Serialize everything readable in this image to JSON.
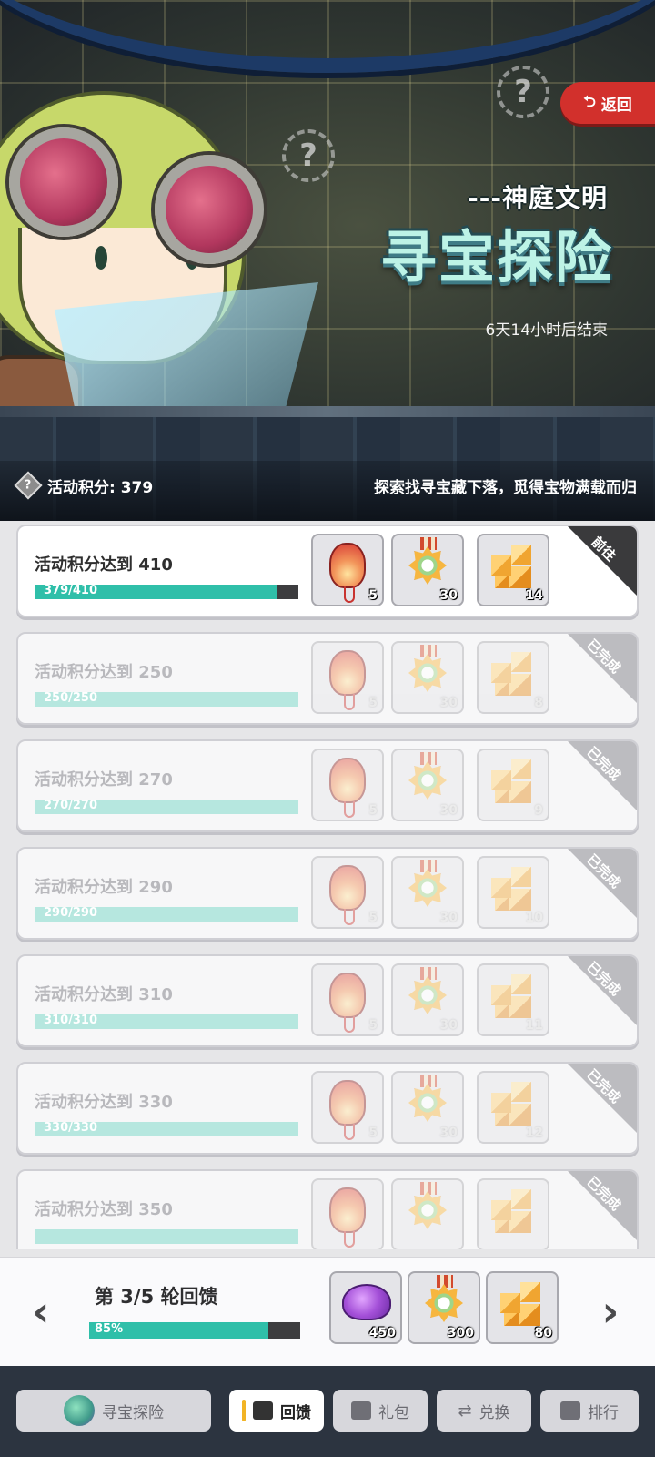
{
  "banner": {
    "back_label": "返回",
    "subtitle": "---神庭文明",
    "title": "寻宝探险",
    "countdown": "6天14小时后结束",
    "score_label": "活动积分: 379",
    "slogan": "探索找寻宝藏下落，觅得宝物满载而归",
    "question_mark": "?"
  },
  "tasks": [
    {
      "title": "活动积分达到 410",
      "progress_text": "379/410",
      "progress": 0.924,
      "status": "前往",
      "done": false,
      "rewards": [
        {
          "icon": "lantern-icon",
          "count": "5"
        },
        {
          "icon": "medal-icon",
          "count": "30"
        },
        {
          "icon": "cubes-icon",
          "count": "14"
        }
      ]
    },
    {
      "title": "活动积分达到 250",
      "progress_text": "250/250",
      "progress": 1.0,
      "status": "已完成",
      "done": true,
      "rewards": [
        {
          "icon": "lantern-icon",
          "count": "5"
        },
        {
          "icon": "medal-icon",
          "count": "30"
        },
        {
          "icon": "cubes-icon",
          "count": "8"
        }
      ]
    },
    {
      "title": "活动积分达到 270",
      "progress_text": "270/270",
      "progress": 1.0,
      "status": "已完成",
      "done": true,
      "rewards": [
        {
          "icon": "lantern-icon",
          "count": "5"
        },
        {
          "icon": "medal-icon",
          "count": "30"
        },
        {
          "icon": "cubes-icon",
          "count": "9"
        }
      ]
    },
    {
      "title": "活动积分达到 290",
      "progress_text": "290/290",
      "progress": 1.0,
      "status": "已完成",
      "done": true,
      "rewards": [
        {
          "icon": "lantern-icon",
          "count": "5"
        },
        {
          "icon": "medal-icon",
          "count": "30"
        },
        {
          "icon": "cubes-icon",
          "count": "10"
        }
      ]
    },
    {
      "title": "活动积分达到 310",
      "progress_text": "310/310",
      "progress": 1.0,
      "status": "已完成",
      "done": true,
      "rewards": [
        {
          "icon": "lantern-icon",
          "count": "5"
        },
        {
          "icon": "medal-icon",
          "count": "30"
        },
        {
          "icon": "cubes-icon",
          "count": "11"
        }
      ]
    },
    {
      "title": "活动积分达到 330",
      "progress_text": "330/330",
      "progress": 1.0,
      "status": "已完成",
      "done": true,
      "rewards": [
        {
          "icon": "lantern-icon",
          "count": "5"
        },
        {
          "icon": "medal-icon",
          "count": "30"
        },
        {
          "icon": "cubes-icon",
          "count": "12"
        }
      ]
    },
    {
      "title": "活动积分达到 350",
      "progress_text": "",
      "progress": 1.0,
      "status": "已完成",
      "done": true,
      "rewards": [
        {
          "icon": "lantern-icon",
          "count": ""
        },
        {
          "icon": "medal-icon",
          "count": ""
        },
        {
          "icon": "cubes-icon",
          "count": ""
        }
      ]
    }
  ],
  "round": {
    "title": "第 3/5 轮回馈",
    "progress_text": "85%",
    "progress": 0.85,
    "rewards": [
      {
        "icon": "gem-icon",
        "count": "450"
      },
      {
        "icon": "medal-icon",
        "count": "300"
      },
      {
        "icon": "cubes-icon",
        "count": "80"
      }
    ],
    "prev_arrow": "‹",
    "next_arrow": "›"
  },
  "nav": {
    "treasure": "寻宝探险",
    "feedback": "回馈",
    "gift": "礼包",
    "exchange": "兑换",
    "rank": "排行"
  },
  "colors": {
    "accent_teal": "#2fbfa9",
    "back_red": "#d2302c",
    "active_tab_marker": "#f2b426"
  }
}
